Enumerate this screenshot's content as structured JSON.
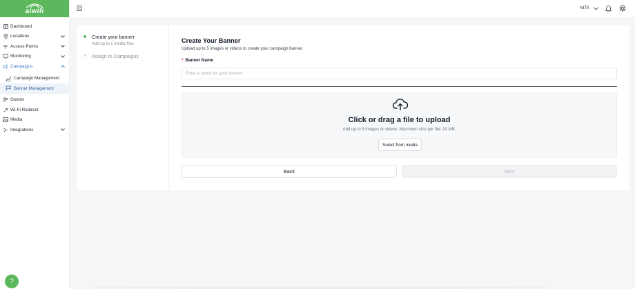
{
  "brand": {
    "logo_text": "aiwifi",
    "accent": "#5cb85c"
  },
  "sidebar": {
    "items": [
      {
        "label": "Dashboard",
        "icon": "dashboard-icon"
      },
      {
        "label": "Locations",
        "icon": "location-pin-icon",
        "expandable": true
      },
      {
        "label": "Access Points",
        "icon": "access-point-icon",
        "expandable": true
      },
      {
        "label": "Monitoring",
        "icon": "monitor-icon",
        "expandable": true
      },
      {
        "label": "Campaigns",
        "icon": "megaphone-icon",
        "expandable": true,
        "expanded": true
      },
      {
        "label": "Guests",
        "icon": "users-icon"
      },
      {
        "label": "Wi-Fi Redirect",
        "icon": "redirect-icon"
      },
      {
        "label": "Media",
        "icon": "image-icon"
      },
      {
        "label": "Integrations",
        "icon": "integrations-icon",
        "expandable": true
      }
    ],
    "campaign_subitems": [
      {
        "label": "Campaign Management",
        "icon": "chart-icon"
      },
      {
        "label": "Banner Management",
        "icon": "flag-icon",
        "active": true
      }
    ],
    "help_label": "?"
  },
  "header": {
    "user_name": "NITA"
  },
  "steps": [
    {
      "title": "Create your banner",
      "subtitle": "Add up to 5 media files",
      "active": true
    },
    {
      "title": "Assign to Campaigns",
      "subtitle": "",
      "active": false
    }
  ],
  "form": {
    "title": "Create Your Banner",
    "subtitle": "Upload up to 5 images or videos to create your campaign banner.",
    "name_label": "Banner Name",
    "required_mark": "*",
    "name_placeholder": "Enter a name for your banner.",
    "name_value": ""
  },
  "upload": {
    "title": "Click or drag a file to upload",
    "subtitle": "Add up to 5 images or videos. Maximum size per file: 10 MB.",
    "media_button": "Select from media"
  },
  "actions": {
    "back": "Back",
    "next": "Next"
  }
}
